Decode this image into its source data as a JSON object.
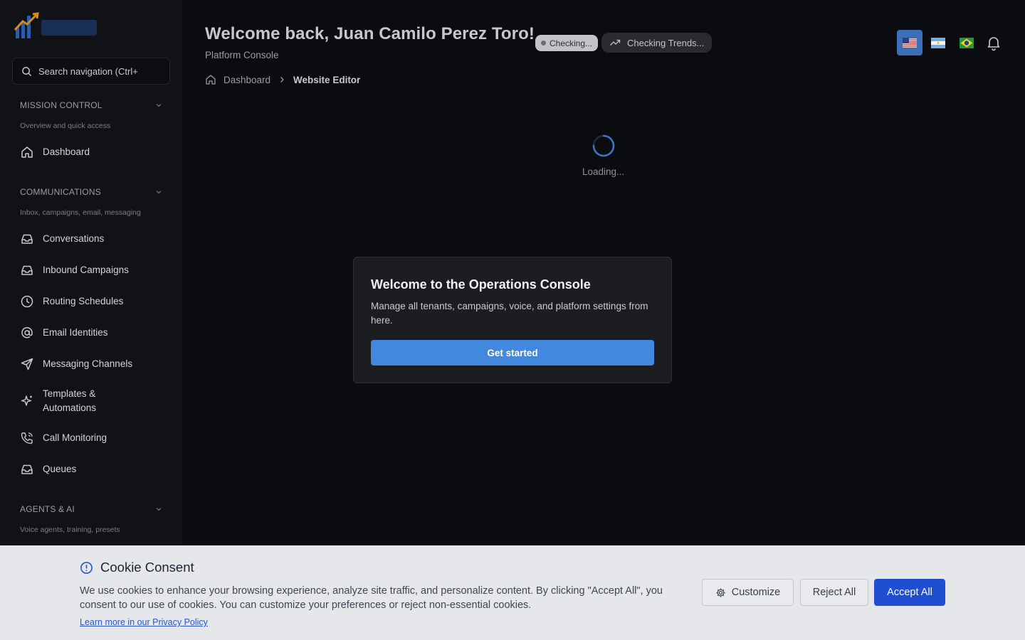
{
  "sidebar": {
    "search_placeholder": "Search navigation (Ctrl+",
    "sections": [
      {
        "title": "MISSION CONTROL",
        "subtitle": "Overview and quick access",
        "items": [
          {
            "label": "Dashboard",
            "icon": "home-icon"
          }
        ]
      },
      {
        "title": "COMMUNICATIONS",
        "subtitle": "Inbox, campaigns, email, messaging",
        "items": [
          {
            "label": "Conversations",
            "icon": "inbox-icon"
          },
          {
            "label": "Inbound Campaigns",
            "icon": "inbox-icon"
          },
          {
            "label": "Routing Schedules",
            "icon": "clock-icon"
          },
          {
            "label": "Email Identities",
            "icon": "at-sign-icon"
          },
          {
            "label": "Messaging Channels",
            "icon": "send-icon"
          },
          {
            "label": "Templates & Automations",
            "icon": "sparkles-icon"
          },
          {
            "label": "Call Monitoring",
            "icon": "phone-call-icon"
          },
          {
            "label": "Queues",
            "icon": "inbox-icon"
          }
        ]
      },
      {
        "title": "AGENTS & AI",
        "subtitle": "Voice agents, training, presets",
        "items": []
      }
    ]
  },
  "header": {
    "welcome": "Welcome back, Juan Camilo Perez Toro!",
    "subtitle": "Platform Console",
    "status_pill": "Checking...",
    "trend_pill": "Checking Trends...",
    "languages": [
      {
        "code": "en-US",
        "icon": "us-flag-icon",
        "active": true
      },
      {
        "code": "es-AR",
        "icon": "argentina-flag-icon",
        "active": false
      },
      {
        "code": "pt-BR",
        "icon": "brazil-flag-icon",
        "active": false
      }
    ]
  },
  "breadcrumb": {
    "items": [
      "Dashboard",
      "Website Editor"
    ]
  },
  "main": {
    "loading_text": "Loading..."
  },
  "modal": {
    "title": "Welcome to the Operations Console",
    "body": "Manage all tenants, campaigns, voice, and platform settings from here.",
    "button": "Get started"
  },
  "cookie": {
    "title": "Cookie Consent",
    "text": "We use cookies to enhance your browsing experience, analyze site traffic, and personalize content. By clicking \"Accept All\", you consent to our use of cookies. You can customize your preferences or reject non-essential cookies.",
    "link": "Learn more in our Privacy Policy",
    "customize": "Customize",
    "reject": "Reject All",
    "accept": "Accept All"
  },
  "colors": {
    "primary": "#4188de",
    "accept": "#1f4ed0",
    "active_flag_bg": "#3c6fb8",
    "sidebar_bg": "#111215",
    "page_bg": "#0b0c0f"
  }
}
